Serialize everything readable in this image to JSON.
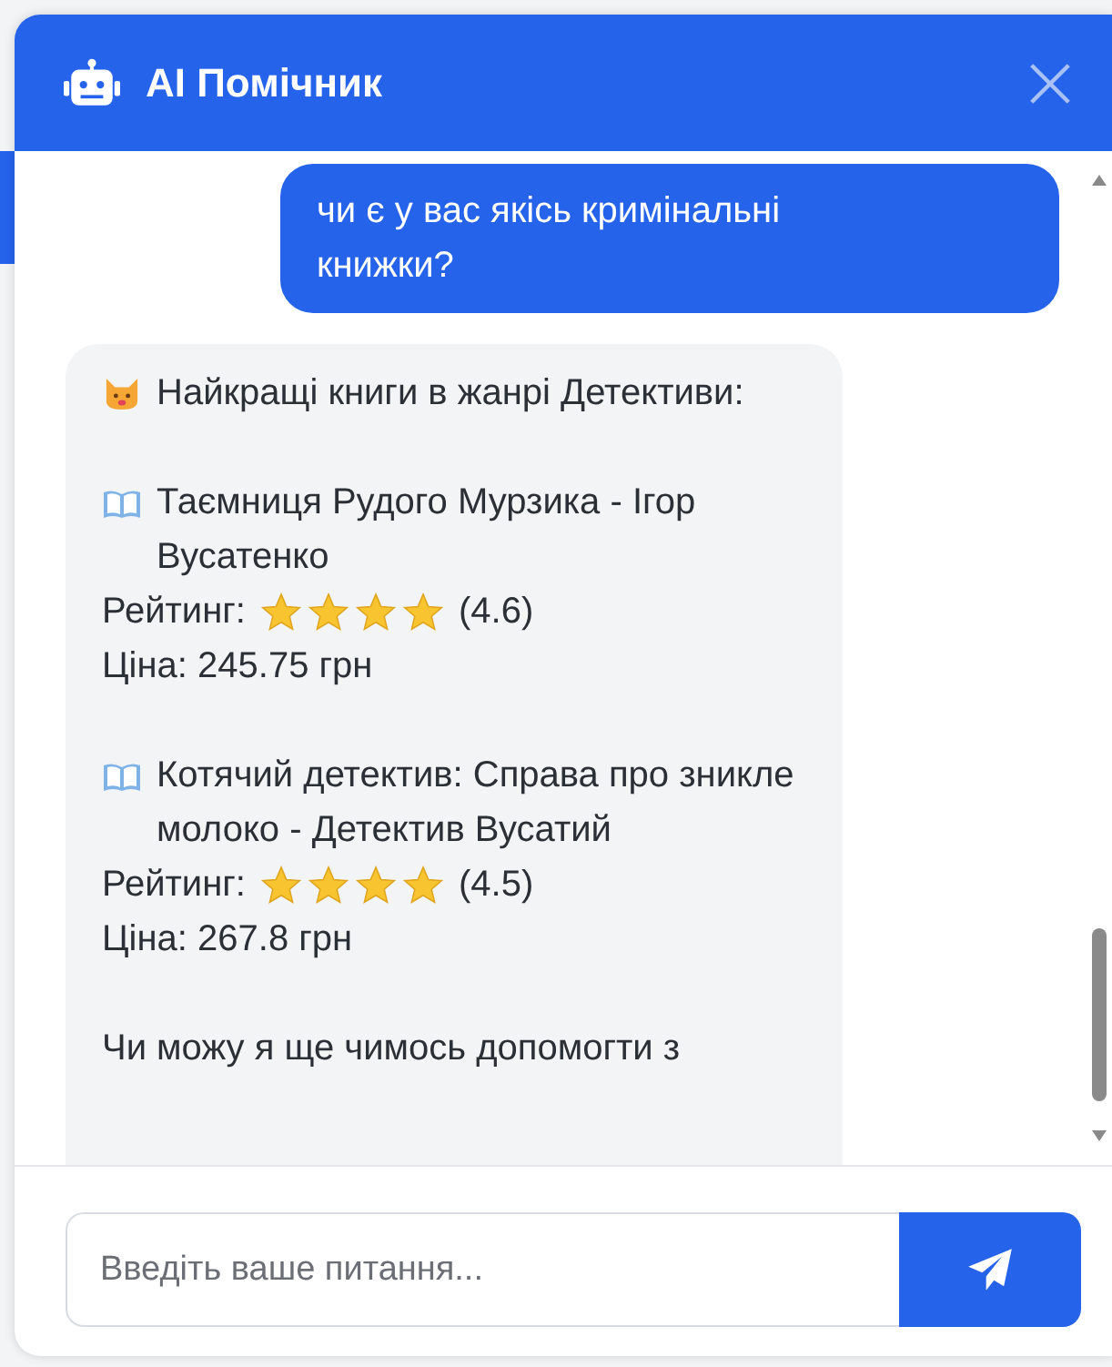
{
  "header": {
    "title": "AI Помічник"
  },
  "messages": [
    {
      "kind": "user",
      "text": "чи є у вас якісь кримінальні книжки?"
    },
    {
      "kind": "bot",
      "intro": "Найкращі книги в жанрі Детективи:",
      "books": [
        {
          "title": "Таємниця Рудого Мурзика - Ігор Вусатенко",
          "rating_label": "Рейтинг:",
          "stars": 4,
          "rating": "(4.6)",
          "price": "Ціна: 245.75 грн"
        },
        {
          "title": "Котячий детектив: Справа про зникле молоко - Детектив Вусатий",
          "rating_label": "Рейтинг:",
          "stars": 4,
          "rating": "(4.5)",
          "price": "Ціна: 267.8 грн"
        }
      ],
      "outro": "Чи можу я ще чимось допомогти з"
    }
  ],
  "input": {
    "placeholder": "Введіть ваше питання..."
  }
}
